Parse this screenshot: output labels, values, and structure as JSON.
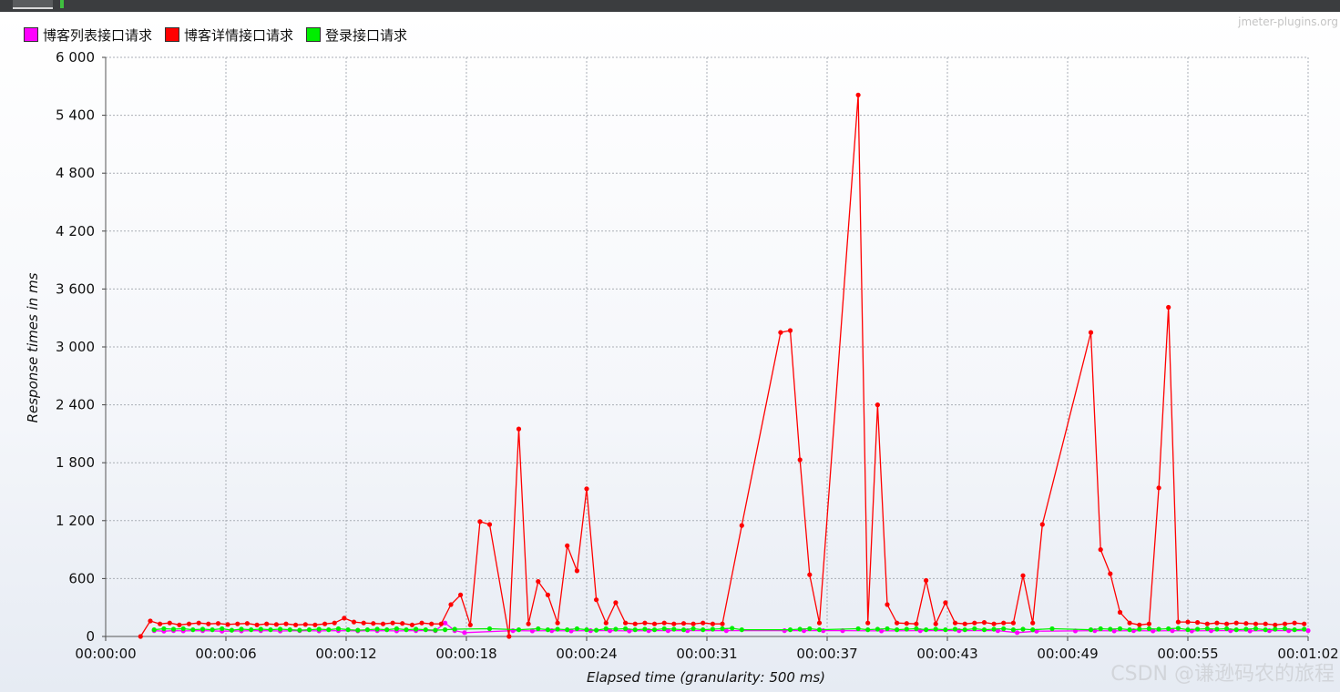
{
  "chart_data": {
    "type": "line",
    "title": "",
    "xlabel": "Elapsed time (granularity: 500 ms)",
    "ylabel": "Response times in ms",
    "ylim": [
      0,
      6000
    ],
    "xlim_seconds": [
      0,
      62
    ],
    "y_ticks": [
      "0",
      "600",
      "1 200",
      "1 800",
      "2 400",
      "3 000",
      "3 600",
      "4 200",
      "4 800",
      "5 400",
      "6 000"
    ],
    "x_ticks": [
      "00:00:00",
      "00:00:06",
      "00:00:12",
      "00:00:18",
      "00:00:24",
      "00:00:31",
      "00:00:37",
      "00:00:43",
      "00:00:49",
      "00:00:55",
      "00:01:02"
    ],
    "grid": true,
    "legend_position": "top-left",
    "series": [
      {
        "name": "博客列表接口请求",
        "color": "#ff00ff",
        "points": [
          [
            2.5,
            60
          ],
          [
            3,
            55
          ],
          [
            3.5,
            60
          ],
          [
            4,
            58
          ],
          [
            5,
            60
          ],
          [
            6,
            55
          ],
          [
            7,
            58
          ],
          [
            8,
            60
          ],
          [
            9,
            57
          ],
          [
            10,
            60
          ],
          [
            11,
            58
          ],
          [
            12,
            60
          ],
          [
            13,
            58
          ],
          [
            14,
            60
          ],
          [
            15,
            58
          ],
          [
            16,
            60
          ],
          [
            17,
            60
          ],
          [
            17.5,
            140
          ],
          [
            18,
            60
          ],
          [
            18.5,
            40
          ],
          [
            21,
            60
          ],
          [
            22,
            58
          ],
          [
            23,
            60
          ],
          [
            24,
            58
          ],
          [
            25,
            60
          ],
          [
            26,
            60
          ],
          [
            27,
            58
          ],
          [
            28,
            60
          ],
          [
            29,
            60
          ],
          [
            30,
            60
          ],
          [
            32,
            60
          ],
          [
            35,
            60
          ],
          [
            36,
            60
          ],
          [
            37,
            60
          ],
          [
            38,
            60
          ],
          [
            40,
            58
          ],
          [
            42,
            60
          ],
          [
            44,
            60
          ],
          [
            46,
            60
          ],
          [
            47,
            40
          ],
          [
            48,
            55
          ],
          [
            50,
            58
          ],
          [
            51,
            60
          ],
          [
            52,
            58
          ],
          [
            53,
            60
          ],
          [
            54,
            58
          ],
          [
            55,
            60
          ],
          [
            56,
            58
          ],
          [
            57,
            60
          ],
          [
            58,
            60
          ],
          [
            59,
            58
          ],
          [
            60,
            60
          ],
          [
            61,
            60
          ],
          [
            62,
            60
          ]
        ]
      },
      {
        "name": "博客详情接口请求",
        "color": "#ff0000",
        "points": [
          [
            1.8,
            0
          ],
          [
            2.3,
            160
          ],
          [
            2.8,
            130
          ],
          [
            3.3,
            140
          ],
          [
            3.8,
            120
          ],
          [
            4.3,
            130
          ],
          [
            4.8,
            140
          ],
          [
            5.3,
            130
          ],
          [
            5.8,
            135
          ],
          [
            6.3,
            125
          ],
          [
            6.8,
            130
          ],
          [
            7.3,
            135
          ],
          [
            7.8,
            120
          ],
          [
            8.3,
            130
          ],
          [
            8.8,
            125
          ],
          [
            9.3,
            130
          ],
          [
            9.8,
            120
          ],
          [
            10.3,
            125
          ],
          [
            10.8,
            120
          ],
          [
            11.3,
            130
          ],
          [
            11.8,
            140
          ],
          [
            12.3,
            190
          ],
          [
            12.8,
            150
          ],
          [
            13.3,
            140
          ],
          [
            13.8,
            135
          ],
          [
            14.3,
            130
          ],
          [
            14.8,
            140
          ],
          [
            15.3,
            135
          ],
          [
            15.8,
            120
          ],
          [
            16.3,
            140
          ],
          [
            16.8,
            130
          ],
          [
            17.3,
            130
          ],
          [
            17.8,
            330
          ],
          [
            18.3,
            430
          ],
          [
            18.8,
            120
          ],
          [
            19.3,
            1190
          ],
          [
            19.8,
            1160
          ],
          [
            20.8,
            0
          ],
          [
            21.3,
            2150
          ],
          [
            21.8,
            130
          ],
          [
            22.3,
            570
          ],
          [
            22.8,
            430
          ],
          [
            23.3,
            140
          ],
          [
            23.8,
            940
          ],
          [
            24.3,
            680
          ],
          [
            24.8,
            1530
          ],
          [
            25.3,
            380
          ],
          [
            25.8,
            140
          ],
          [
            26.3,
            350
          ],
          [
            26.8,
            140
          ],
          [
            27.3,
            130
          ],
          [
            27.8,
            140
          ],
          [
            28.3,
            130
          ],
          [
            28.8,
            140
          ],
          [
            29.3,
            130
          ],
          [
            29.8,
            135
          ],
          [
            30.3,
            130
          ],
          [
            30.8,
            140
          ],
          [
            31.3,
            130
          ],
          [
            31.8,
            130
          ],
          [
            32.8,
            1150
          ],
          [
            34.8,
            3150
          ],
          [
            35.3,
            3170
          ],
          [
            35.8,
            1830
          ],
          [
            36.3,
            640
          ],
          [
            36.8,
            140
          ],
          [
            38.8,
            5610
          ],
          [
            39.3,
            140
          ],
          [
            39.8,
            2400
          ],
          [
            40.3,
            330
          ],
          [
            40.8,
            140
          ],
          [
            41.3,
            135
          ],
          [
            41.8,
            130
          ],
          [
            42.3,
            580
          ],
          [
            42.8,
            130
          ],
          [
            43.3,
            350
          ],
          [
            43.8,
            140
          ],
          [
            44.3,
            130
          ],
          [
            44.8,
            140
          ],
          [
            45.3,
            145
          ],
          [
            45.8,
            130
          ],
          [
            46.3,
            140
          ],
          [
            46.8,
            140
          ],
          [
            47.3,
            630
          ],
          [
            47.8,
            140
          ],
          [
            48.3,
            1160
          ],
          [
            50.8,
            3150
          ],
          [
            51.3,
            900
          ],
          [
            51.8,
            650
          ],
          [
            52.3,
            250
          ],
          [
            52.8,
            140
          ],
          [
            53.3,
            120
          ],
          [
            53.8,
            130
          ],
          [
            54.3,
            1540
          ],
          [
            54.8,
            3410
          ],
          [
            55.3,
            150
          ],
          [
            55.8,
            150
          ],
          [
            56.3,
            145
          ],
          [
            56.8,
            130
          ],
          [
            57.3,
            140
          ],
          [
            57.8,
            130
          ],
          [
            58.3,
            140
          ],
          [
            58.8,
            135
          ],
          [
            59.3,
            130
          ],
          [
            59.8,
            130
          ],
          [
            60.3,
            120
          ],
          [
            60.8,
            130
          ],
          [
            61.3,
            140
          ],
          [
            61.8,
            130
          ]
        ]
      },
      {
        "name": "登录接口请求",
        "color": "#00ee00",
        "points": [
          [
            2.5,
            70
          ],
          [
            3,
            80
          ],
          [
            3.5,
            75
          ],
          [
            4,
            80
          ],
          [
            4.5,
            70
          ],
          [
            5,
            75
          ],
          [
            5.5,
            70
          ],
          [
            6,
            80
          ],
          [
            6.5,
            65
          ],
          [
            7,
            75
          ],
          [
            7.5,
            70
          ],
          [
            8,
            75
          ],
          [
            8.5,
            70
          ],
          [
            9,
            75
          ],
          [
            9.5,
            70
          ],
          [
            10,
            65
          ],
          [
            10.5,
            70
          ],
          [
            11,
            75
          ],
          [
            11.5,
            70
          ],
          [
            12,
            80
          ],
          [
            12.5,
            70
          ],
          [
            13,
            65
          ],
          [
            13.5,
            70
          ],
          [
            14,
            75
          ],
          [
            14.5,
            70
          ],
          [
            15,
            80
          ],
          [
            15.5,
            70
          ],
          [
            16,
            75
          ],
          [
            16.5,
            70
          ],
          [
            17,
            65
          ],
          [
            17.5,
            70
          ],
          [
            18,
            75
          ],
          [
            19.8,
            80
          ],
          [
            21.3,
            70
          ],
          [
            22.3,
            80
          ],
          [
            22.8,
            70
          ],
          [
            23.3,
            75
          ],
          [
            23.8,
            70
          ],
          [
            24.3,
            80
          ],
          [
            24.8,
            70
          ],
          [
            25.3,
            65
          ],
          [
            25.8,
            80
          ],
          [
            26.3,
            75
          ],
          [
            26.8,
            80
          ],
          [
            27.3,
            70
          ],
          [
            27.8,
            75
          ],
          [
            28.3,
            70
          ],
          [
            28.8,
            80
          ],
          [
            29.3,
            75
          ],
          [
            29.8,
            70
          ],
          [
            30.3,
            80
          ],
          [
            30.8,
            70
          ],
          [
            31.3,
            75
          ],
          [
            31.8,
            80
          ],
          [
            32.3,
            85
          ],
          [
            32.8,
            70
          ],
          [
            35.3,
            70
          ],
          [
            35.8,
            75
          ],
          [
            36.3,
            80
          ],
          [
            36.8,
            70
          ],
          [
            38.8,
            80
          ],
          [
            39.3,
            70
          ],
          [
            39.8,
            75
          ],
          [
            40.3,
            80
          ],
          [
            40.8,
            70
          ],
          [
            41.3,
            75
          ],
          [
            41.8,
            80
          ],
          [
            42.3,
            70
          ],
          [
            42.8,
            75
          ],
          [
            43.3,
            70
          ],
          [
            43.8,
            75
          ],
          [
            44.3,
            70
          ],
          [
            44.8,
            80
          ],
          [
            45.3,
            70
          ],
          [
            45.8,
            75
          ],
          [
            46.3,
            80
          ],
          [
            46.8,
            70
          ],
          [
            47.3,
            75
          ],
          [
            47.8,
            70
          ],
          [
            48.8,
            80
          ],
          [
            50.8,
            70
          ],
          [
            51.3,
            80
          ],
          [
            51.8,
            75
          ],
          [
            52.3,
            80
          ],
          [
            52.8,
            70
          ],
          [
            53.3,
            75
          ],
          [
            53.8,
            80
          ],
          [
            54.3,
            75
          ],
          [
            54.8,
            80
          ],
          [
            55.3,
            85
          ],
          [
            55.8,
            70
          ],
          [
            56.3,
            75
          ],
          [
            56.8,
            80
          ],
          [
            57.3,
            75
          ],
          [
            57.8,
            80
          ],
          [
            58.3,
            70
          ],
          [
            58.8,
            75
          ],
          [
            59.3,
            80
          ],
          [
            59.8,
            70
          ],
          [
            60.3,
            75
          ],
          [
            60.8,
            80
          ],
          [
            61.3,
            70
          ],
          [
            61.8,
            75
          ]
        ]
      }
    ]
  },
  "watermarks": {
    "top": "jmeter-plugins.org",
    "bottom": "CSDN @谦逊码农的旅程"
  }
}
